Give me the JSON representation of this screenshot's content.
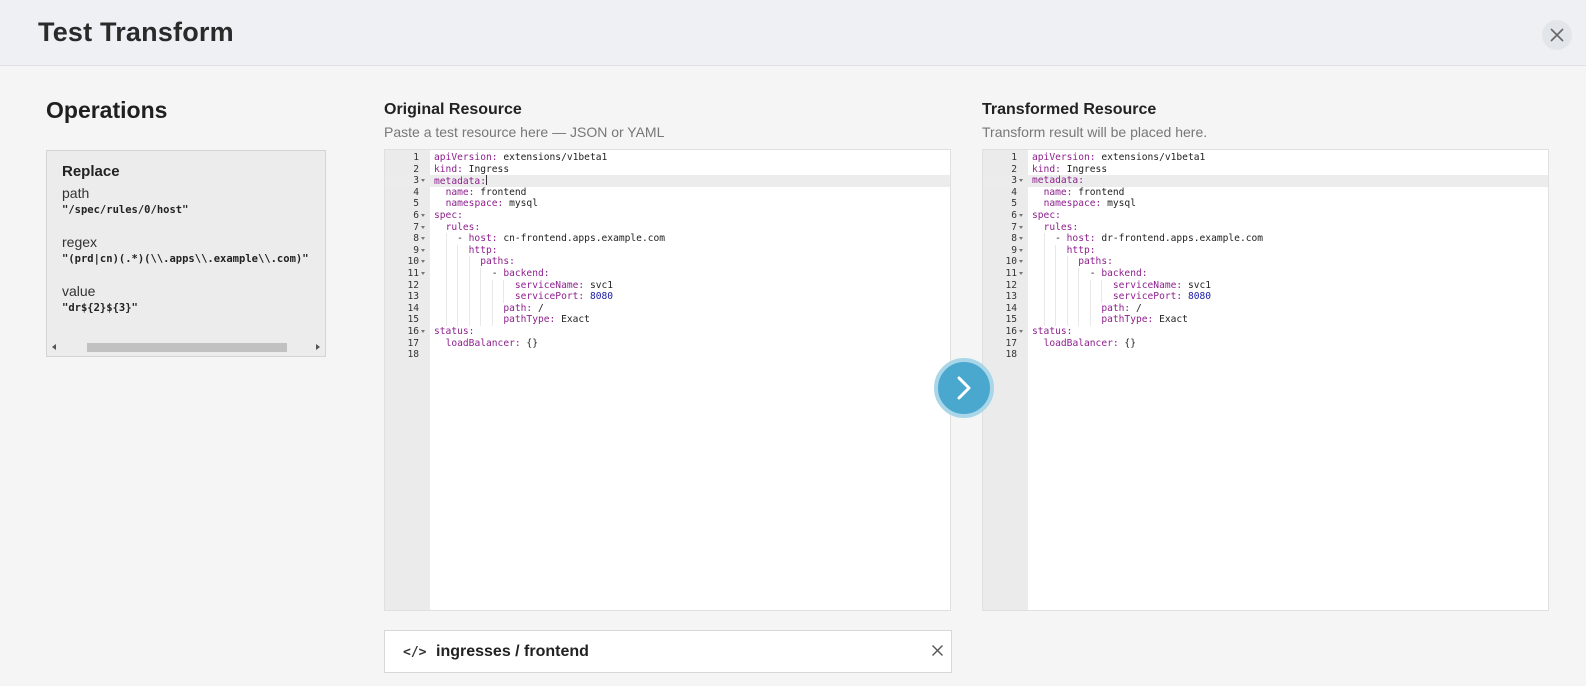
{
  "header": {
    "title": "Test Transform"
  },
  "operations": {
    "title": "Operations",
    "items": [
      {
        "type": "Replace",
        "fields": [
          {
            "label": "path",
            "value": "\"/spec/rules/0/host\""
          },
          {
            "label": "regex",
            "value": "\"(prd|cn)(.*)(\\\\.apps\\\\.example\\\\.com)\""
          },
          {
            "label": "value",
            "value": "\"dr${2}${3}\""
          }
        ]
      }
    ]
  },
  "original": {
    "title": "Original Resource",
    "subtitle": "Paste a test resource here — JSON or YAML",
    "lines": [
      [
        [
          "k",
          "apiVersion:"
        ],
        [
          "t",
          " extensions/v1beta1"
        ]
      ],
      [
        [
          "k",
          "kind:"
        ],
        [
          "t",
          " Ingress"
        ]
      ],
      [
        [
          "k",
          "metadata:"
        ]
      ],
      [
        [
          "t",
          "  "
        ],
        [
          "k",
          "name:"
        ],
        [
          "t",
          " frontend"
        ]
      ],
      [
        [
          "t",
          "  "
        ],
        [
          "k",
          "namespace:"
        ],
        [
          "t",
          " mysql"
        ]
      ],
      [
        [
          "k",
          "spec:"
        ]
      ],
      [
        [
          "t",
          "  "
        ],
        [
          "k",
          "rules:"
        ]
      ],
      [
        [
          "t",
          "    - "
        ],
        [
          "k",
          "host:"
        ],
        [
          "t",
          " cn-frontend.apps.example.com"
        ]
      ],
      [
        [
          "t",
          "      "
        ],
        [
          "k",
          "http:"
        ]
      ],
      [
        [
          "t",
          "        "
        ],
        [
          "k",
          "paths:"
        ]
      ],
      [
        [
          "t",
          "          - "
        ],
        [
          "k",
          "backend:"
        ]
      ],
      [
        [
          "t",
          "              "
        ],
        [
          "k",
          "serviceName:"
        ],
        [
          "t",
          " svc1"
        ]
      ],
      [
        [
          "t",
          "              "
        ],
        [
          "k",
          "servicePort:"
        ],
        [
          "n",
          " 8080"
        ]
      ],
      [
        [
          "t",
          "            "
        ],
        [
          "k",
          "path:"
        ],
        [
          "t",
          " /"
        ]
      ],
      [
        [
          "t",
          "            "
        ],
        [
          "k",
          "pathType:"
        ],
        [
          "t",
          " Exact"
        ]
      ],
      [
        [
          "k",
          "status:"
        ]
      ],
      [
        [
          "t",
          "  "
        ],
        [
          "k",
          "loadBalancer:"
        ],
        [
          "t",
          " {}"
        ]
      ],
      []
    ]
  },
  "transformed": {
    "title": "Transformed Resource",
    "subtitle": "Transform result will be placed here.",
    "lines": [
      [
        [
          "k",
          "apiVersion:"
        ],
        [
          "t",
          " extensions/v1beta1"
        ]
      ],
      [
        [
          "k",
          "kind:"
        ],
        [
          "t",
          " Ingress"
        ]
      ],
      [
        [
          "k",
          "metadata:"
        ]
      ],
      [
        [
          "t",
          "  "
        ],
        [
          "k",
          "name:"
        ],
        [
          "t",
          " frontend"
        ]
      ],
      [
        [
          "t",
          "  "
        ],
        [
          "k",
          "namespace:"
        ],
        [
          "t",
          " mysql"
        ]
      ],
      [
        [
          "k",
          "spec:"
        ]
      ],
      [
        [
          "t",
          "  "
        ],
        [
          "k",
          "rules:"
        ]
      ],
      [
        [
          "t",
          "    - "
        ],
        [
          "k",
          "host:"
        ],
        [
          "t",
          " dr-frontend.apps.example.com"
        ]
      ],
      [
        [
          "t",
          "      "
        ],
        [
          "k",
          "http:"
        ]
      ],
      [
        [
          "t",
          "        "
        ],
        [
          "k",
          "paths:"
        ]
      ],
      [
        [
          "t",
          "          - "
        ],
        [
          "k",
          "backend:"
        ]
      ],
      [
        [
          "t",
          "              "
        ],
        [
          "k",
          "serviceName:"
        ],
        [
          "t",
          " svc1"
        ]
      ],
      [
        [
          "t",
          "              "
        ],
        [
          "k",
          "servicePort:"
        ],
        [
          "n",
          " 8080"
        ]
      ],
      [
        [
          "t",
          "            "
        ],
        [
          "k",
          "path:"
        ],
        [
          "t",
          " /"
        ]
      ],
      [
        [
          "t",
          "            "
        ],
        [
          "k",
          "pathType:"
        ],
        [
          "t",
          " Exact"
        ]
      ],
      [
        [
          "k",
          "status:"
        ]
      ],
      [
        [
          "t",
          "  "
        ],
        [
          "k",
          "loadBalancer:"
        ],
        [
          "t",
          " {}"
        ]
      ],
      []
    ]
  },
  "fold_lines": [
    3,
    6,
    7,
    8,
    9,
    10,
    11,
    16
  ],
  "active_line": 3,
  "resource": {
    "icon": "</>",
    "label": "ingresses / frontend"
  },
  "icons": {
    "close": "close-icon",
    "run": "chevron-right-icon",
    "code": "code-icon"
  }
}
